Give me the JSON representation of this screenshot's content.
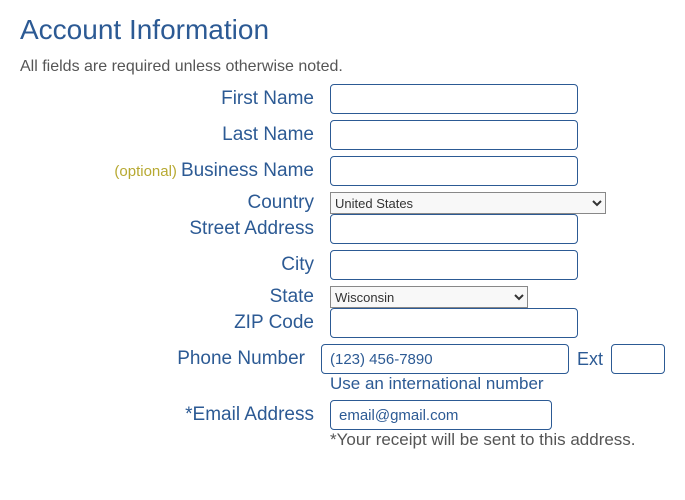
{
  "title": "Account Information",
  "intro": "All fields are required unless otherwise noted.",
  "optional_tag": "(optional)",
  "labels": {
    "first_name": "First Name",
    "last_name": "Last Name",
    "business_name": "Business Name",
    "country": "Country",
    "street_address": "Street Address",
    "city": "City",
    "state": "State",
    "zip_code": "ZIP Code",
    "phone_number": "Phone Number",
    "ext": "Ext",
    "email_address": "*Email Address"
  },
  "values": {
    "first_name": "",
    "last_name": "",
    "business_name": "",
    "country": "United States",
    "street_address": "",
    "city": "",
    "state": "Wisconsin",
    "zip_code": "",
    "phone_number": "(123) 456-7890",
    "ext": "",
    "email_address": "email@gmail.com"
  },
  "intl_link": "Use an international number",
  "receipt_note": "*Your receipt will be sent to this address."
}
